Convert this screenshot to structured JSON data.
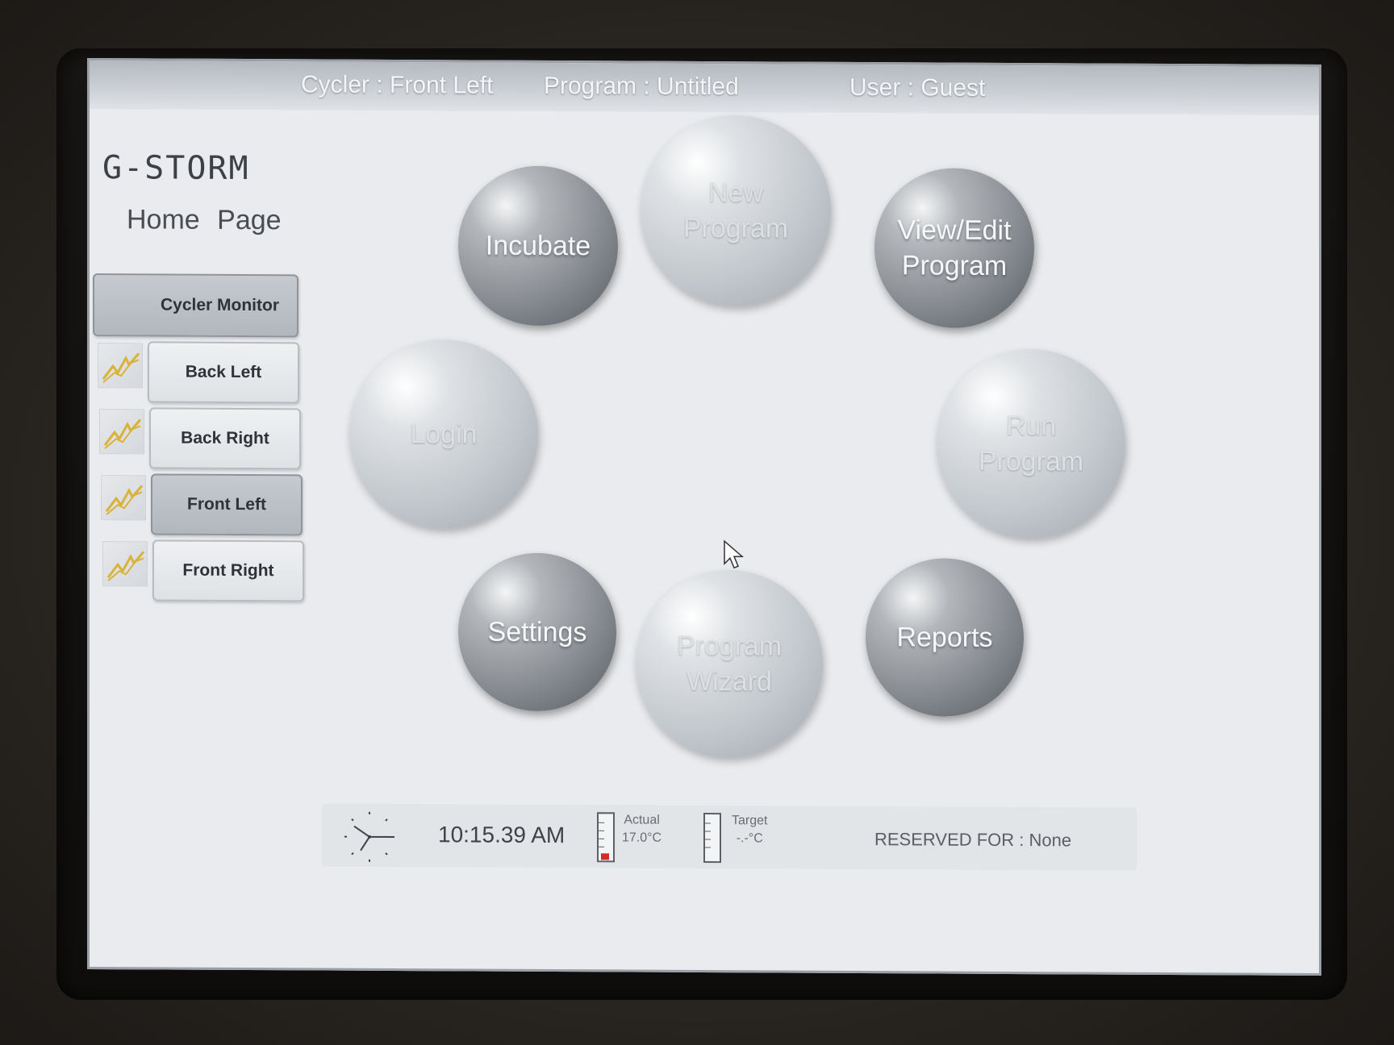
{
  "header": {
    "cycler": "Cycler : Front Left",
    "program": "Program : Untitled",
    "user": "User : Guest"
  },
  "logo": "G-STORM",
  "page_title": "Home Page",
  "sidebar": {
    "monitor_label": "Cycler Monitor",
    "items": [
      {
        "label": "Back Left",
        "icon": "graph-icon"
      },
      {
        "label": "Back Right",
        "icon": "graph-icon"
      },
      {
        "label": "Front Left",
        "icon": "graph-icon",
        "active": true
      },
      {
        "label": "Front Right",
        "icon": "graph-icon"
      }
    ]
  },
  "menu": {
    "incubate": "Incubate",
    "new_program_1": "New",
    "new_program_2": "Program",
    "view_edit_1": "View/Edit",
    "view_edit_2": "Program",
    "login": "Login",
    "run_program_1": "Run",
    "run_program_2": "Program",
    "settings": "Settings",
    "wizard_1": "Program",
    "wizard_2": "Wizard",
    "reports": "Reports"
  },
  "status": {
    "time": "10:15.39 AM",
    "actual_label": "Actual",
    "actual_value": "17.0°C",
    "target_label": "Target",
    "target_value": "-.-°C",
    "reserved": "RESERVED FOR : None"
  },
  "colors": {
    "screen_bg": "#e9ebee",
    "accent_graph": "#d9b23a",
    "thermo_fill": "#d22b2b"
  }
}
